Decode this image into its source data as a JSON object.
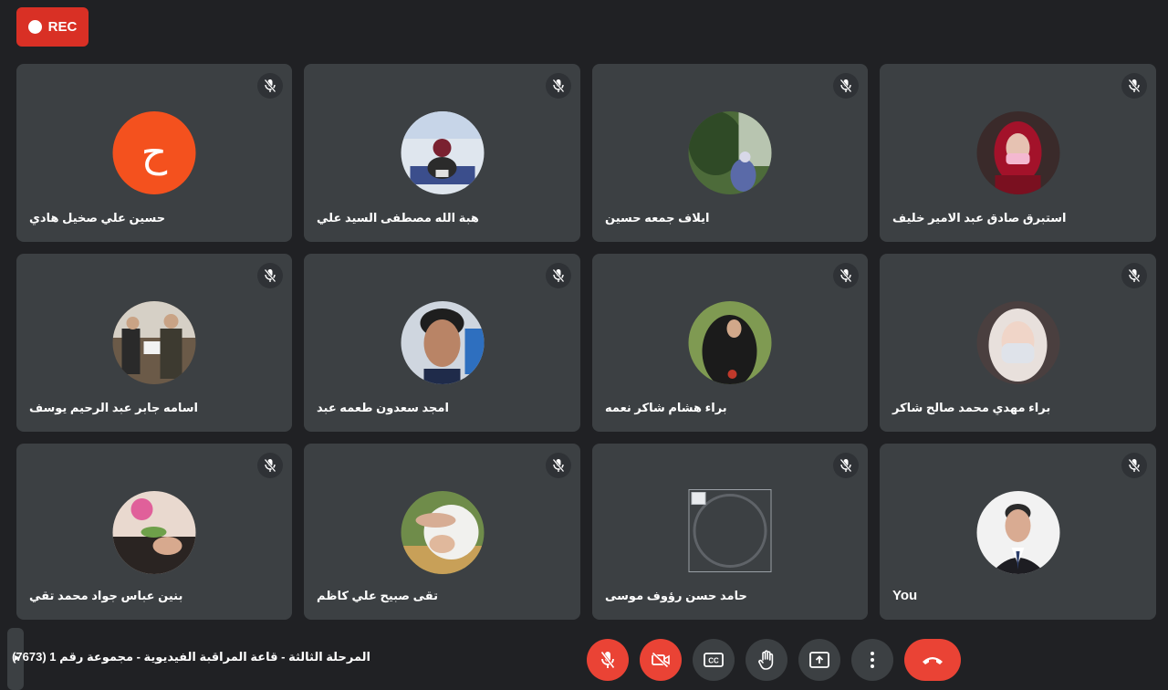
{
  "recording": {
    "label": "REC",
    "color": "#d93025"
  },
  "meeting": {
    "title": "المرحلة الثالثة - قاعة المراقبة الفيديوية - مجموعة رقم 1 (7673)"
  },
  "participants": [
    {
      "name": "حسين علي صخيل هادي",
      "avatar": "letter",
      "initial": "ح",
      "mic": "muted"
    },
    {
      "name": "هبة الله مصطفى السيد علي",
      "avatar": "photo",
      "mic": "muted"
    },
    {
      "name": "ايلاف جمعه حسين",
      "avatar": "photo",
      "mic": "muted"
    },
    {
      "name": "استبرق صادق عبد الامير خليف",
      "avatar": "photo",
      "mic": "muted"
    },
    {
      "name": "اسامه جابر عبد الرحيم يوسف",
      "avatar": "photo",
      "mic": "muted"
    },
    {
      "name": "امجد سعدون طعمه عبد",
      "avatar": "photo",
      "mic": "muted"
    },
    {
      "name": "براء هشام شاكر نعمه",
      "avatar": "photo",
      "mic": "muted"
    },
    {
      "name": "براء مهدي محمد صالح شاكر",
      "avatar": "photo",
      "mic": "muted"
    },
    {
      "name": "بنين عباس جواد محمد تقي",
      "avatar": "photo",
      "mic": "muted"
    },
    {
      "name": "تقى صبيح علي كاظم",
      "avatar": "photo",
      "mic": "muted"
    },
    {
      "name": "حامد حسن رؤوف موسى",
      "avatar": "broken-image",
      "mic": "muted"
    },
    {
      "name": "You",
      "avatar": "photo",
      "mic": "muted"
    }
  ],
  "controls": [
    {
      "name": "microphone-off",
      "icon": "mic-off-icon",
      "state": "off",
      "color": "#ea4335"
    },
    {
      "name": "camera-off",
      "icon": "videocam-off-icon",
      "state": "off",
      "color": "#ea4335"
    },
    {
      "name": "captions",
      "icon": "cc-icon"
    },
    {
      "name": "raise-hand",
      "icon": "hand-icon"
    },
    {
      "name": "present-screen",
      "icon": "present-icon"
    },
    {
      "name": "more-options",
      "icon": "more-vert-icon"
    },
    {
      "name": "leave-call",
      "icon": "call-end-icon",
      "color": "#ea4335"
    }
  ]
}
